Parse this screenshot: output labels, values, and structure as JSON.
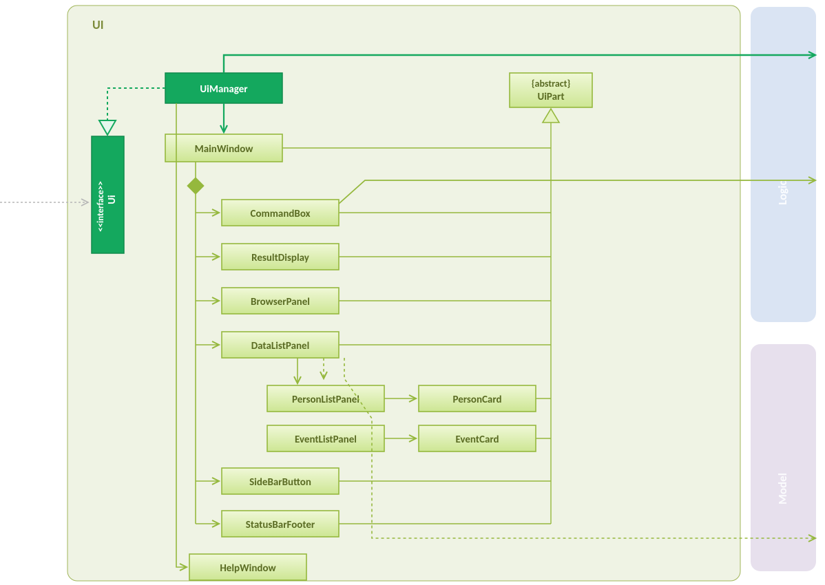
{
  "package": {
    "title": "UI"
  },
  "nodes": {
    "uiInterface": {
      "stereotype": "<<interface>>",
      "name": "Ui"
    },
    "uiManager": {
      "name": "UiManager"
    },
    "mainWindow": {
      "name": "MainWindow"
    },
    "uiPart": {
      "stereotype": "{abstract}",
      "name": "UiPart"
    },
    "commandBox": {
      "name": "CommandBox"
    },
    "resultDisplay": {
      "name": "ResultDisplay"
    },
    "browserPanel": {
      "name": "BrowserPanel"
    },
    "dataListPanel": {
      "name": "DataListPanel"
    },
    "personListPanel": {
      "name": "PersonListPanel"
    },
    "personCard": {
      "name": "PersonCard"
    },
    "eventListPanel": {
      "name": "EventListPanel"
    },
    "eventCard": {
      "name": "EventCard"
    },
    "sideBarButton": {
      "name": "SideBarButton"
    },
    "statusBarFooter": {
      "name": "StatusBarFooter"
    },
    "helpWindow": {
      "name": "HelpWindow"
    }
  },
  "external": {
    "logic": {
      "name": "Logic"
    },
    "model": {
      "name": "Model"
    }
  },
  "colors": {
    "packageFill": "#eff3e4",
    "packageStroke": "#a1b55a",
    "darkGreen": "#14a85e",
    "lightBoxFill1": "#e6f3c1",
    "lightBoxFill2": "#cae58e",
    "lightBoxStroke": "#95b83d",
    "logicFill": "#dae4f3",
    "modelFill": "#e7e0ed",
    "greyStroke": "#b6b6b6"
  }
}
